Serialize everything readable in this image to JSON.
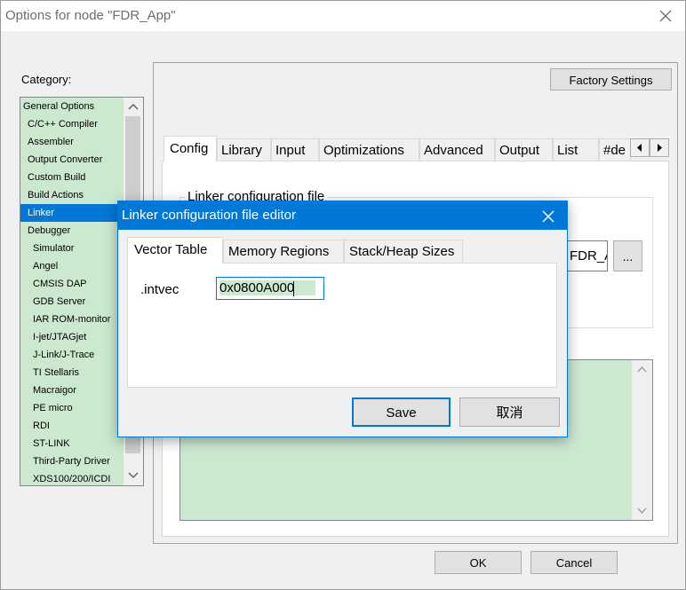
{
  "window": {
    "title": "Options for node \"FDR_App\"",
    "category_label": "Category:",
    "factory_settings_label": "Factory Settings",
    "ok_label": "OK",
    "cancel_label": "Cancel"
  },
  "categories": [
    {
      "label": "General Options",
      "level": 0
    },
    {
      "label": "C/C++ Compiler",
      "level": 1
    },
    {
      "label": "Assembler",
      "level": 1
    },
    {
      "label": "Output Converter",
      "level": 1
    },
    {
      "label": "Custom Build",
      "level": 1
    },
    {
      "label": "Build Actions",
      "level": 1
    },
    {
      "label": "Linker",
      "level": 1,
      "selected": true
    },
    {
      "label": "Debugger",
      "level": 1
    },
    {
      "label": "Simulator",
      "level": 2
    },
    {
      "label": "Angel",
      "level": 2
    },
    {
      "label": "CMSIS DAP",
      "level": 2
    },
    {
      "label": "GDB Server",
      "level": 2
    },
    {
      "label": "IAR ROM-monitor",
      "level": 2
    },
    {
      "label": "I-jet/JTAGjet",
      "level": 2
    },
    {
      "label": "J-Link/J-Trace",
      "level": 2
    },
    {
      "label": "TI Stellaris",
      "level": 2
    },
    {
      "label": "Macraigor",
      "level": 2
    },
    {
      "label": "PE micro",
      "level": 2
    },
    {
      "label": "RDI",
      "level": 2
    },
    {
      "label": "ST-LINK",
      "level": 2
    },
    {
      "label": "Third-Party Driver",
      "level": 2
    },
    {
      "label": "XDS100/200/ICDI",
      "level": 2
    }
  ],
  "linker_tabs": [
    "Config",
    "Library",
    "Input",
    "Optimizations",
    "Advanced",
    "Output",
    "List",
    "#de"
  ],
  "linker_active_tab": "Config",
  "config": {
    "group_label": "Linker configuration file",
    "path_value": "FDR_A",
    "browse_label": "..."
  },
  "editor": {
    "title": "Linker configuration file editor",
    "tabs": [
      "Vector Table",
      "Memory Regions",
      "Stack/Heap Sizes"
    ],
    "active_tab": "Vector Table",
    "field_label": ".intvec",
    "field_value": "0x0800A000",
    "save_label": "Save",
    "cancel_label": "取消"
  },
  "colors": {
    "accent": "#0078d7",
    "list_background": "#cce8cf",
    "selection": "#0078d7",
    "window_background": "#f0f0f0"
  },
  "icons": {
    "close": "close-icon",
    "scroll_up": "chevron-up-icon",
    "scroll_down": "chevron-down-icon",
    "tab_left": "triangle-left-icon",
    "tab_right": "triangle-right-icon"
  }
}
